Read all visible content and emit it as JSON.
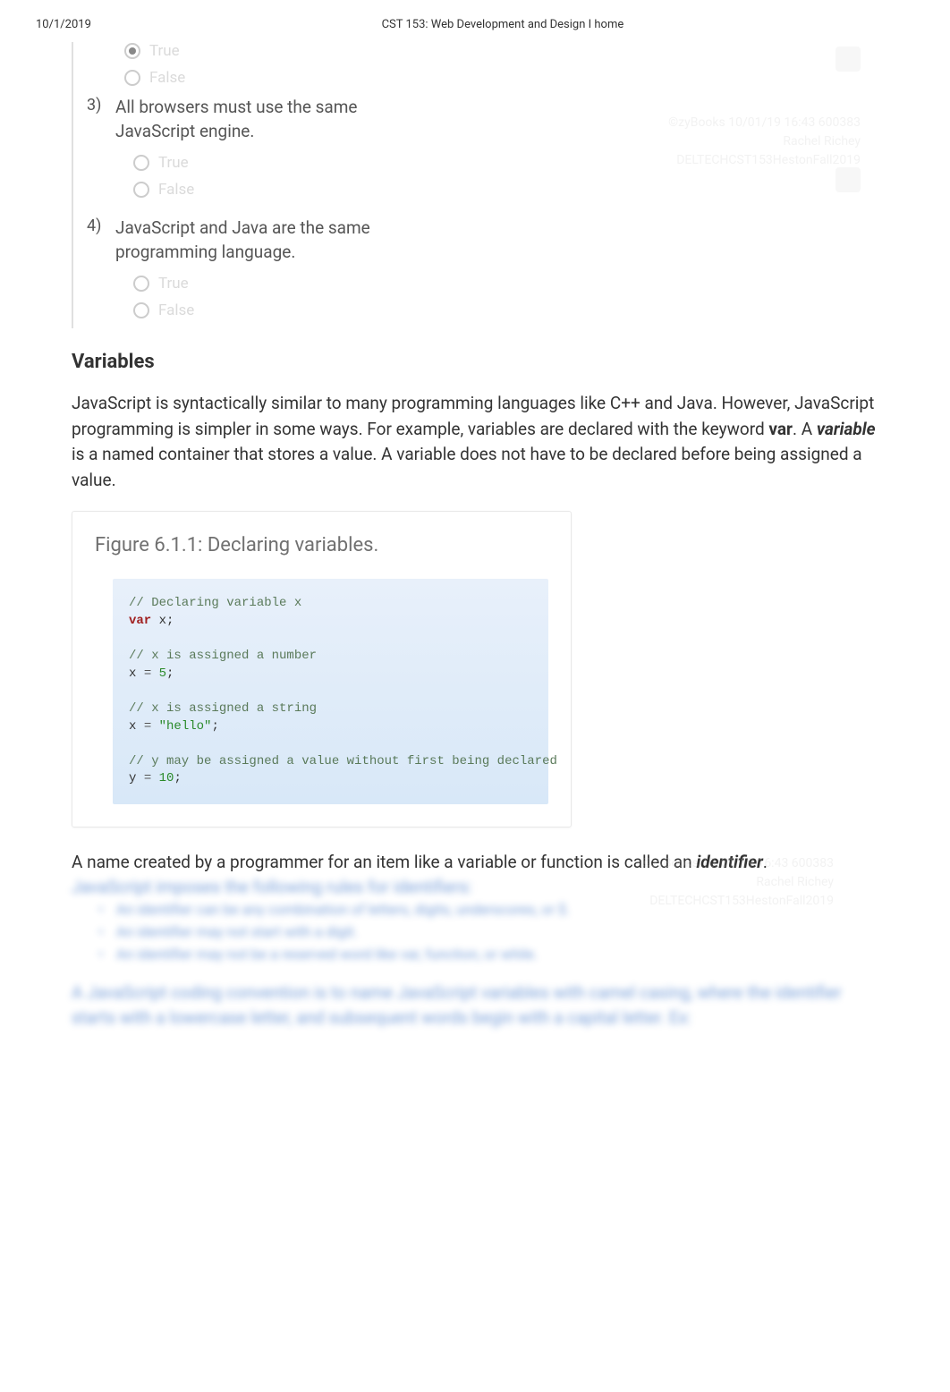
{
  "header": {
    "date": "10/1/2019",
    "title": "CST 153: Web Development and Design I home"
  },
  "questions": [
    {
      "num": "3)",
      "text": "All browsers must use the same JavaScript engine.",
      "options": [
        {
          "label": "True",
          "selected": false
        },
        {
          "label": "False",
          "selected": false
        }
      ],
      "preOptions": [
        {
          "label": "True",
          "selected": true
        },
        {
          "label": "False",
          "selected": false
        }
      ]
    },
    {
      "num": "4)",
      "text": "JavaScript and Java are the same programming language.",
      "options": [
        {
          "label": "True",
          "selected": false
        },
        {
          "label": "False",
          "selected": false
        }
      ]
    }
  ],
  "section": {
    "heading": "Variables",
    "paragraph_pre": "JavaScript is syntactically similar to many programming languages like C++ and Java. However, JavaScript programming is simpler in some ways. For example, variables are declared with the keyword ",
    "kw_var": "var",
    "paragraph_mid": ". A ",
    "kw_variable": "variable",
    "paragraph_post": " is a named container that stores a value. A variable does not have to be declared before being assigned a value."
  },
  "figure": {
    "title": "Figure 6.1.1: Declaring variables.",
    "code": {
      "c1": "// Declaring variable x",
      "l1_kw": "var",
      "l1_rest": " x;",
      "c2": "// x is assigned a number",
      "l2_lhs": "x ",
      "l2_op": "=",
      "l2_num": " 5",
      "l2_end": ";",
      "c3": "// x is assigned a string",
      "l3_lhs": "x ",
      "l3_op": "=",
      "l3_str": " \"hello\"",
      "l3_end": ";",
      "c4": "// y may be assigned a value without first being declared",
      "l4_lhs": "y ",
      "l4_op": "=",
      "l4_num": " 10",
      "l4_end": ";"
    }
  },
  "identifier": {
    "pre": "A name created by a programmer for an item like a variable or function is called an ",
    "term": "identifier",
    "post": ".",
    "blurred_intro": "JavaScript imposes the following rules for identifiers:",
    "rules": [
      "An identifier can be any combination of letters, digits, underscores, or $.",
      "An identifier may not start with a digit.",
      "An identifier may not be a reserved word like var, function, or while."
    ],
    "blurred_para": "A JavaScript coding convention is to name JavaScript variables with camel casing, where the identifier starts with a lowercase letter, and subsequent words begin with a capital letter. Ex:"
  },
  "watermark": {
    "line1": "©zyBooks 10/01/19 16:43 600383",
    "line2": "Rachel Richey",
    "line3": "DELTECHCST153HestonFall2019"
  }
}
